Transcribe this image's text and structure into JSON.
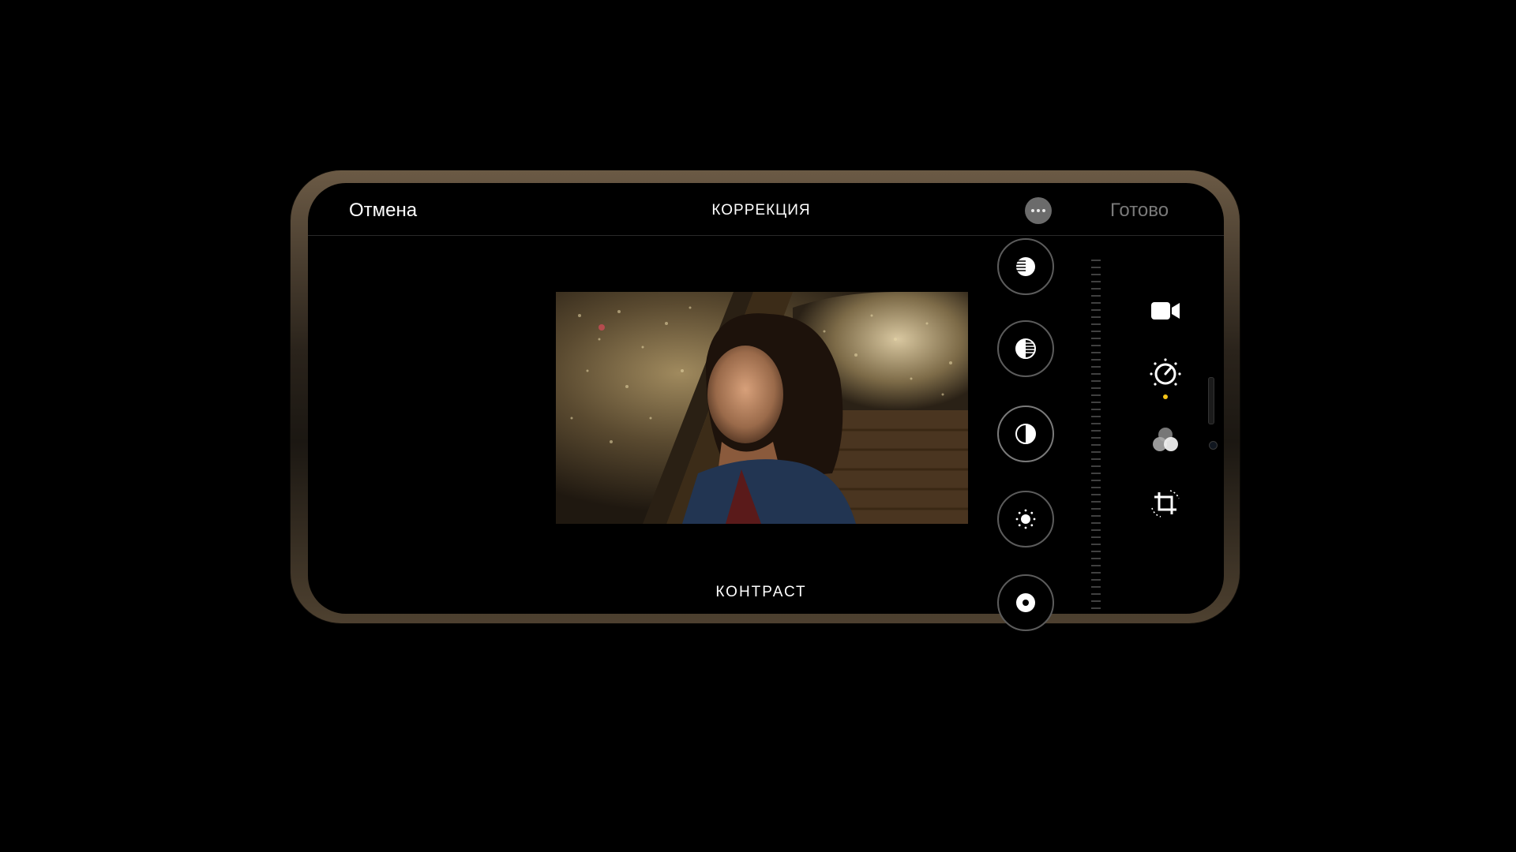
{
  "topbar": {
    "cancel_label": "Отмена",
    "title": "КОРРЕКЦИЯ",
    "done_label": "Готово",
    "more_icon": "ellipsis-circle-icon"
  },
  "editor": {
    "active_adjustment_label": "КОНТРАСТ"
  },
  "adjustment_tools": [
    {
      "name": "highlights",
      "icon": "highlights-icon"
    },
    {
      "name": "shadows-contrast",
      "icon": "half-striped-circle-icon"
    },
    {
      "name": "contrast",
      "icon": "contrast-icon"
    },
    {
      "name": "brightness",
      "icon": "sun-icon"
    },
    {
      "name": "black-point",
      "icon": "dot-circle-icon"
    }
  ],
  "side_tools": [
    {
      "name": "video",
      "icon": "video-camera-icon"
    },
    {
      "name": "adjust",
      "icon": "adjust-dial-icon",
      "active": true
    },
    {
      "name": "filters",
      "icon": "filters-icon"
    },
    {
      "name": "crop",
      "icon": "crop-rotate-icon"
    }
  ],
  "colors": {
    "accent": "#f5c518",
    "text": "#ffffff",
    "muted": "#7a7a7a"
  }
}
